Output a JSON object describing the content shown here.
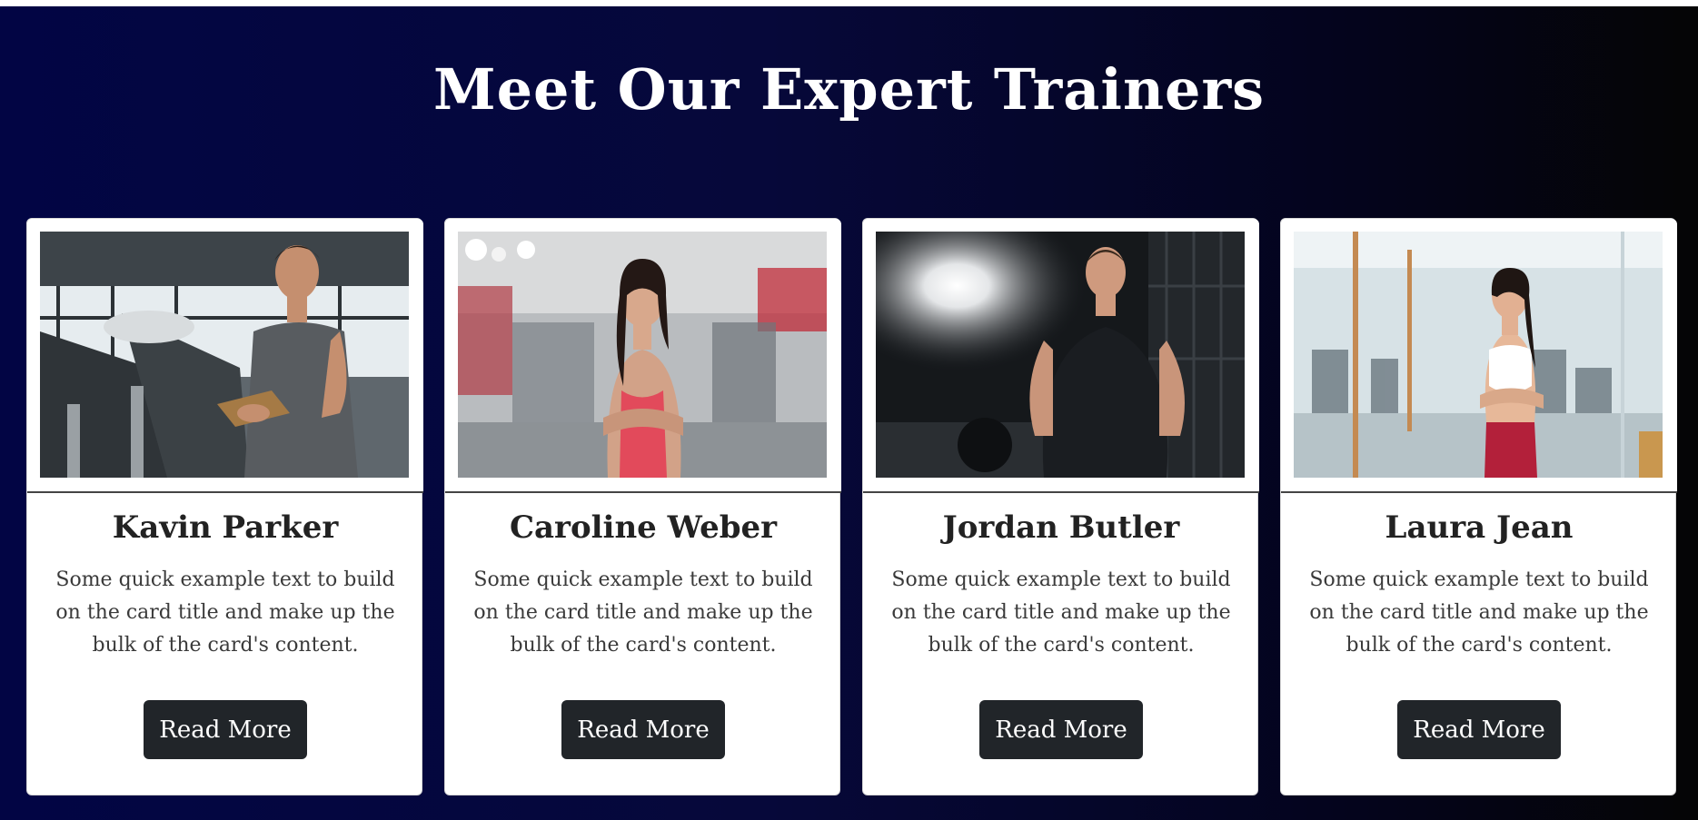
{
  "section": {
    "title": "Meet Our Expert Trainers"
  },
  "trainers": [
    {
      "name": "Kavin Parker",
      "description": "Some quick example text to build on the card title and make up the bulk of the card's content.",
      "button_label": "Read More"
    },
    {
      "name": "Caroline Weber",
      "description": "Some quick example text to build on the card title and make up the bulk of the card's content.",
      "button_label": "Read More"
    },
    {
      "name": "Jordan Butler",
      "description": "Some quick example text to build on the card title and make up the bulk of the card's content.",
      "button_label": "Read More"
    },
    {
      "name": "Laura Jean",
      "description": "Some quick example text to build on the card title and make up the bulk of the card's content.",
      "button_label": "Read More"
    }
  ],
  "colors": {
    "background_gradient_start": "#020544",
    "background_gradient_end": "#050505",
    "button_bg": "#212529",
    "button_text": "#ffffff"
  }
}
